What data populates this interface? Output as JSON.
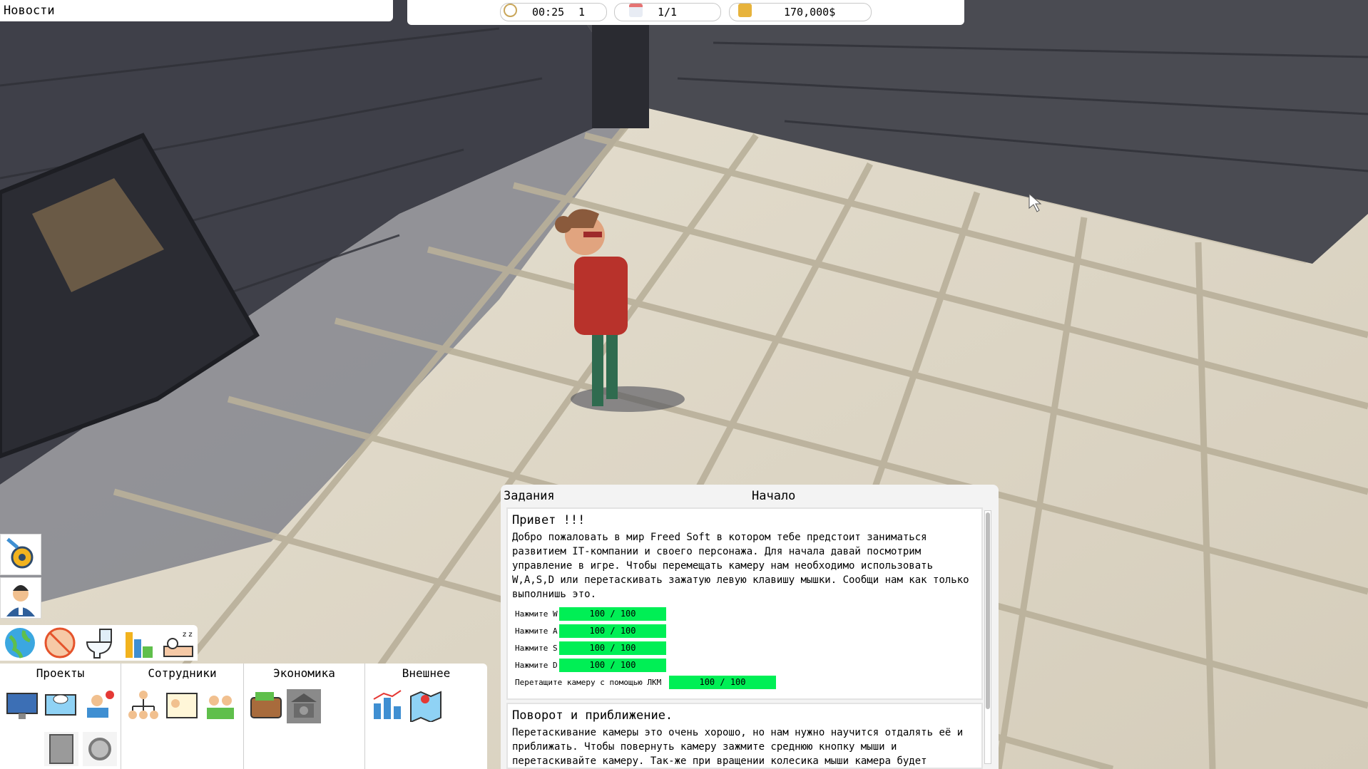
{
  "news": {
    "title": "Новости"
  },
  "topbar": {
    "time": "00:25",
    "speed": "1",
    "days": "1/1",
    "money": "170,000$",
    "icons": [
      "clock-icon",
      "calendar-icon",
      "coins-icon"
    ]
  },
  "tasks": {
    "header_left": "Задания",
    "header_center": "Начало",
    "card1": {
      "title": "Привет !!!",
      "body": "Добро пожаловать в мир Freed Soft в котором тебе предстоит заниматься развитием IT-компании и своего персонажа. Для начала давай посмотрим управление в игре. Чтобы перемещать камеру нам необходимо использовать W,A,S,D или перетаскивать зажатую левую клавишу мышки. Сообщи нам как только выполнишь это.",
      "progress": [
        {
          "label": "Нажмите W",
          "value": "100 / 100",
          "fraction": 1.0
        },
        {
          "label": "Нажмите A",
          "value": "100 / 100",
          "fraction": 1.0
        },
        {
          "label": "Нажмите S",
          "value": "100 / 100",
          "fraction": 1.0
        },
        {
          "label": "Нажмите D",
          "value": "100 / 100",
          "fraction": 1.0
        },
        {
          "label": "Перетащите камеру с помощью ЛКМ",
          "value": "100 / 100",
          "fraction": 1.0
        }
      ]
    },
    "card2": {
      "title": "Поворот и приближение.",
      "body": "Перетаскивание камеры это очень хорошо, но нам нужно научится отдалять её и приближать. Чтобы повернуть камеру зажмите среднюю кнопку мыши и перетаскивайте камеру. Так-же при вращении колесика мыши камера будет"
    }
  },
  "side_buttons": [
    "settings-gear-icon",
    "employee-avatar-icon"
  ],
  "quick_icons": [
    "globe-icon",
    "no-food-icon",
    "toilet-icon",
    "shelves-icon",
    "sleep-icon"
  ],
  "menu": {
    "tabs": [
      {
        "label": "Проекты",
        "icons": [
          "software-computer-icon",
          "api-monitor-icon",
          "support-operator-icon",
          "server-icon",
          "settings-cog-icon"
        ]
      },
      {
        "label": "Сотрудники",
        "icons": [
          "org-structure-icon",
          "job-board-icon",
          "team-icon"
        ]
      },
      {
        "label": "Экономика",
        "icons": [
          "wallet-icon",
          "bank-icon"
        ]
      },
      {
        "label": "Внешнее",
        "icons": [
          "city-stats-icon",
          "map-icon"
        ]
      }
    ]
  },
  "colors": {
    "progress": "#00ef55",
    "panel": "#ffffff"
  }
}
